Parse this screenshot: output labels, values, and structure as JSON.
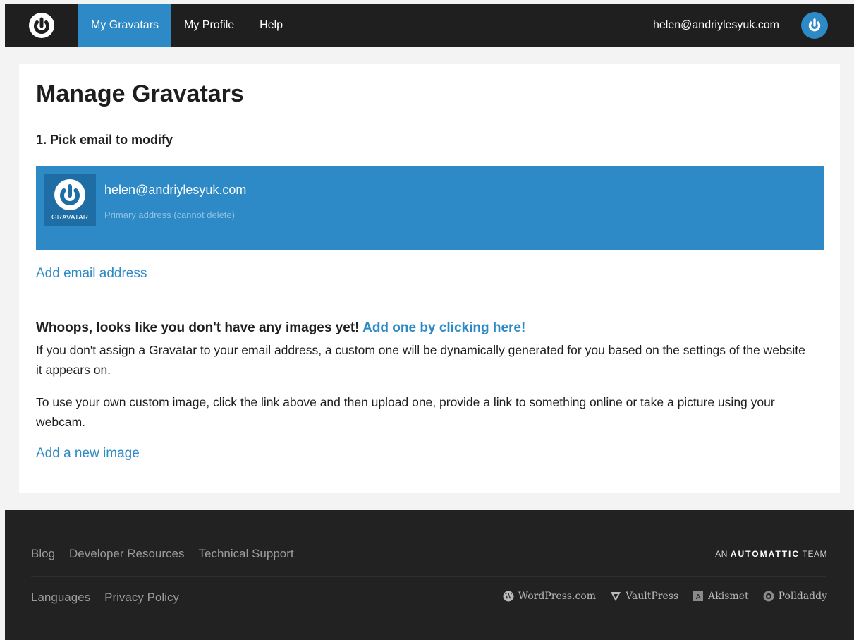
{
  "header": {
    "nav": [
      {
        "label": "My Gravatars",
        "active": true
      },
      {
        "label": "My Profile",
        "active": false
      },
      {
        "label": "Help",
        "active": false
      }
    ],
    "user_email": "helen@andriylesyuk.com",
    "logo_icon": "gravatar-logo-icon",
    "avatar_icon": "gravatar-avatar-icon"
  },
  "main": {
    "title": "Manage Gravatars",
    "step_title": "1. Pick email to modify",
    "email_card": {
      "email": "helen@andriylesyuk.com",
      "subtitle": "Primary address (cannot delete)",
      "tile_label": "GRAVATAR"
    },
    "add_email_link": "Add email address",
    "empty_heading": "Whoops, looks like you don't have any images yet!",
    "empty_heading_link": "Add one by clicking here!",
    "paragraph1": "If you don't assign a Gravatar to your email address, a custom one will be dynamically generated for you based on the settings of the website it appears on.",
    "paragraph2": "To use your own custom image, click the link above and then upload one, provide a link to something online or take a picture using your webcam.",
    "add_image_link": "Add a new image"
  },
  "footer": {
    "links_row1": [
      "Blog",
      "Developer Resources",
      "Technical Support"
    ],
    "links_row2": [
      "Languages",
      "Privacy Policy"
    ],
    "automattic_prefix": "AN",
    "automattic_brand": "AUTOMATTIC",
    "automattic_suffix": "TEAM",
    "brands": [
      {
        "label": "WordPress.com",
        "icon": "wordpress-icon"
      },
      {
        "label": "VaultPress",
        "icon": "vaultpress-icon"
      },
      {
        "label": "Akismet",
        "icon": "akismet-icon"
      },
      {
        "label": "Polldaddy",
        "icon": "polldaddy-icon"
      }
    ]
  },
  "colors": {
    "accent": "#2d8ac6",
    "topbar": "#1f1f1f",
    "footer": "#222222"
  }
}
